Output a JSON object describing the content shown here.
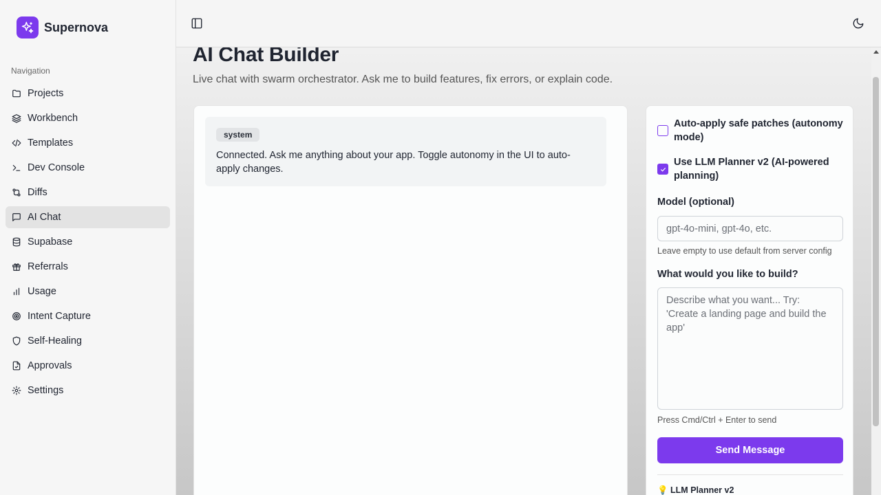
{
  "app": {
    "name": "Supernova"
  },
  "sidebar": {
    "heading": "Navigation",
    "items": [
      {
        "label": "Projects",
        "icon": "folder-icon"
      },
      {
        "label": "Workbench",
        "icon": "layers-icon"
      },
      {
        "label": "Templates",
        "icon": "code-icon"
      },
      {
        "label": "Dev Console",
        "icon": "terminal-icon"
      },
      {
        "label": "Diffs",
        "icon": "git-compare-icon"
      },
      {
        "label": "AI Chat",
        "icon": "message-square-icon",
        "active": true
      },
      {
        "label": "Supabase",
        "icon": "database-icon"
      },
      {
        "label": "Referrals",
        "icon": "gift-icon"
      },
      {
        "label": "Usage",
        "icon": "bar-chart-icon"
      },
      {
        "label": "Intent Capture",
        "icon": "target-icon"
      },
      {
        "label": "Self-Healing",
        "icon": "shield-icon"
      },
      {
        "label": "Approvals",
        "icon": "file-check-icon"
      },
      {
        "label": "Settings",
        "icon": "gear-icon"
      }
    ]
  },
  "page": {
    "title": "AI Chat Builder",
    "subtitle": "Live chat with swarm orchestrator. Ask me to build features, fix errors, or explain code."
  },
  "chat": {
    "messages": [
      {
        "role": "system",
        "text": "Connected. Ask me anything about your app. Toggle autonomy in the UI to auto-apply changes."
      }
    ]
  },
  "panel": {
    "autonomy_label": "Auto-apply safe patches (autonomy mode)",
    "autonomy_checked": false,
    "planner_label": "Use LLM Planner v2 (AI-powered planning)",
    "planner_checked": true,
    "model_label": "Model (optional)",
    "model_placeholder": "gpt-4o-mini, gpt-4o, etc.",
    "model_value": "",
    "model_hint": "Leave empty to use default from server config",
    "prompt_label": "What would you like to build?",
    "prompt_placeholder": "Describe what you want... Try: 'Create a landing page and build the app'",
    "prompt_value": "",
    "send_hint": "Press Cmd/Ctrl + Enter to send",
    "send_label": "Send Message",
    "planner_note": "💡 LLM Planner v2"
  },
  "colors": {
    "accent": "#7c3aed"
  }
}
